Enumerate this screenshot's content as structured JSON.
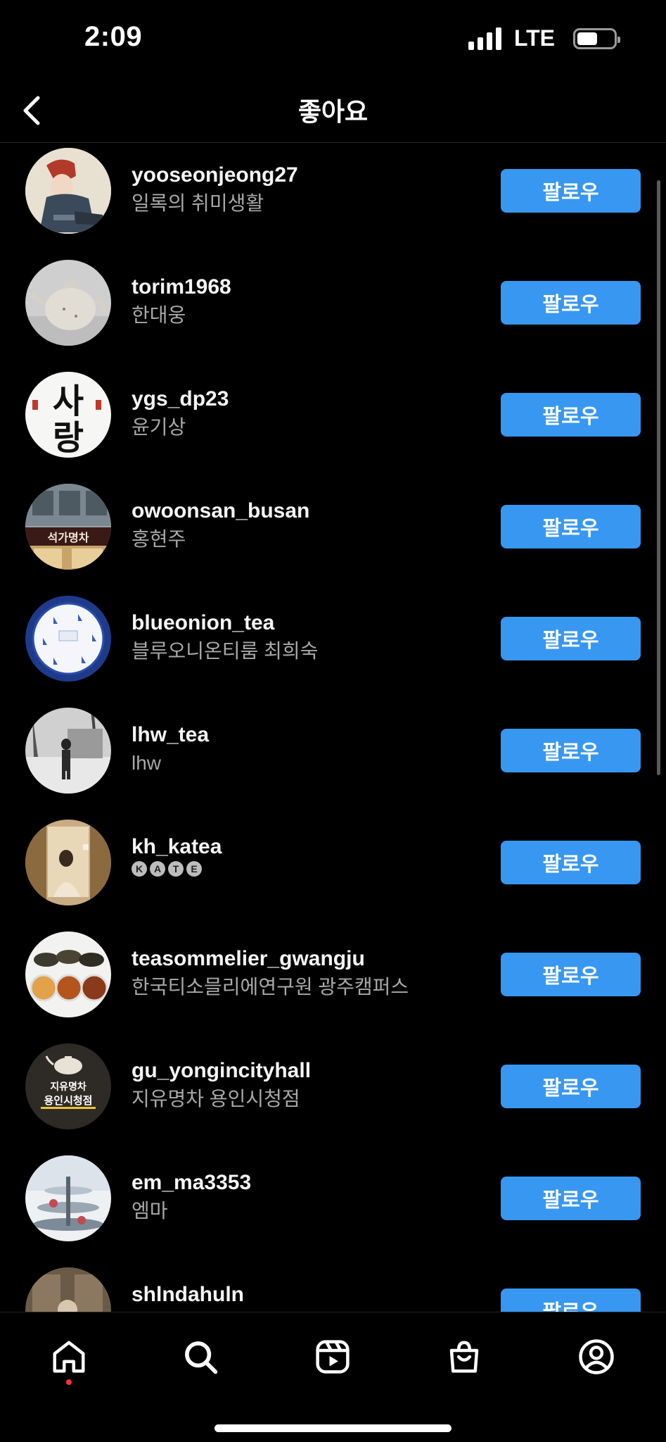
{
  "status_bar": {
    "time": "2:09",
    "network": "LTE",
    "battery_level": 0.55
  },
  "header": {
    "title": "좋아요"
  },
  "users": [
    {
      "username": "yooseonjeong27",
      "fullname": "일록의 취미생활",
      "follow_label": "팔로우"
    },
    {
      "username": "torim1968",
      "fullname": "한대웅",
      "follow_label": "팔로우"
    },
    {
      "username": "ygs_dp23",
      "fullname": "윤기상",
      "follow_label": "팔로우"
    },
    {
      "username": "owoonsan_busan",
      "fullname": "홍현주",
      "follow_label": "팔로우"
    },
    {
      "username": "blueonion_tea",
      "fullname": "블루오니온티룸 최희숙",
      "follow_label": "팔로우"
    },
    {
      "username": "lhw_tea",
      "fullname": "lhw",
      "follow_label": "팔로우"
    },
    {
      "username": "kh_katea",
      "fullname": "",
      "fullname_badges": [
        "K",
        "A",
        "T",
        "E"
      ],
      "follow_label": "팔로우"
    },
    {
      "username": "teasommelier_gwangju",
      "fullname": "한국티소믈리에연구원 광주캠퍼스",
      "follow_label": "팔로우"
    },
    {
      "username": "gu_yongincityhall",
      "fullname": "지유명차 용인시청점",
      "follow_label": "팔로우"
    },
    {
      "username": "em_ma3353",
      "fullname": "엠마",
      "follow_label": "팔로우"
    },
    {
      "username": "shlndahuln",
      "fullname": "",
      "follow_label": "팔로우"
    }
  ],
  "avatar_text": {
    "ygs": [
      "사",
      "랑"
    ],
    "owoonsan": "석가명차",
    "yongin_line1": "지유명차",
    "yongin_line2": "용인시청점"
  },
  "tabs": [
    {
      "name": "home-icon",
      "active": true
    },
    {
      "name": "search-icon"
    },
    {
      "name": "reels-icon"
    },
    {
      "name": "shop-icon"
    },
    {
      "name": "profile-icon"
    }
  ],
  "colors": {
    "follow_button": "#3897f0",
    "notification_dot": "#ff3040",
    "background": "#000000"
  }
}
